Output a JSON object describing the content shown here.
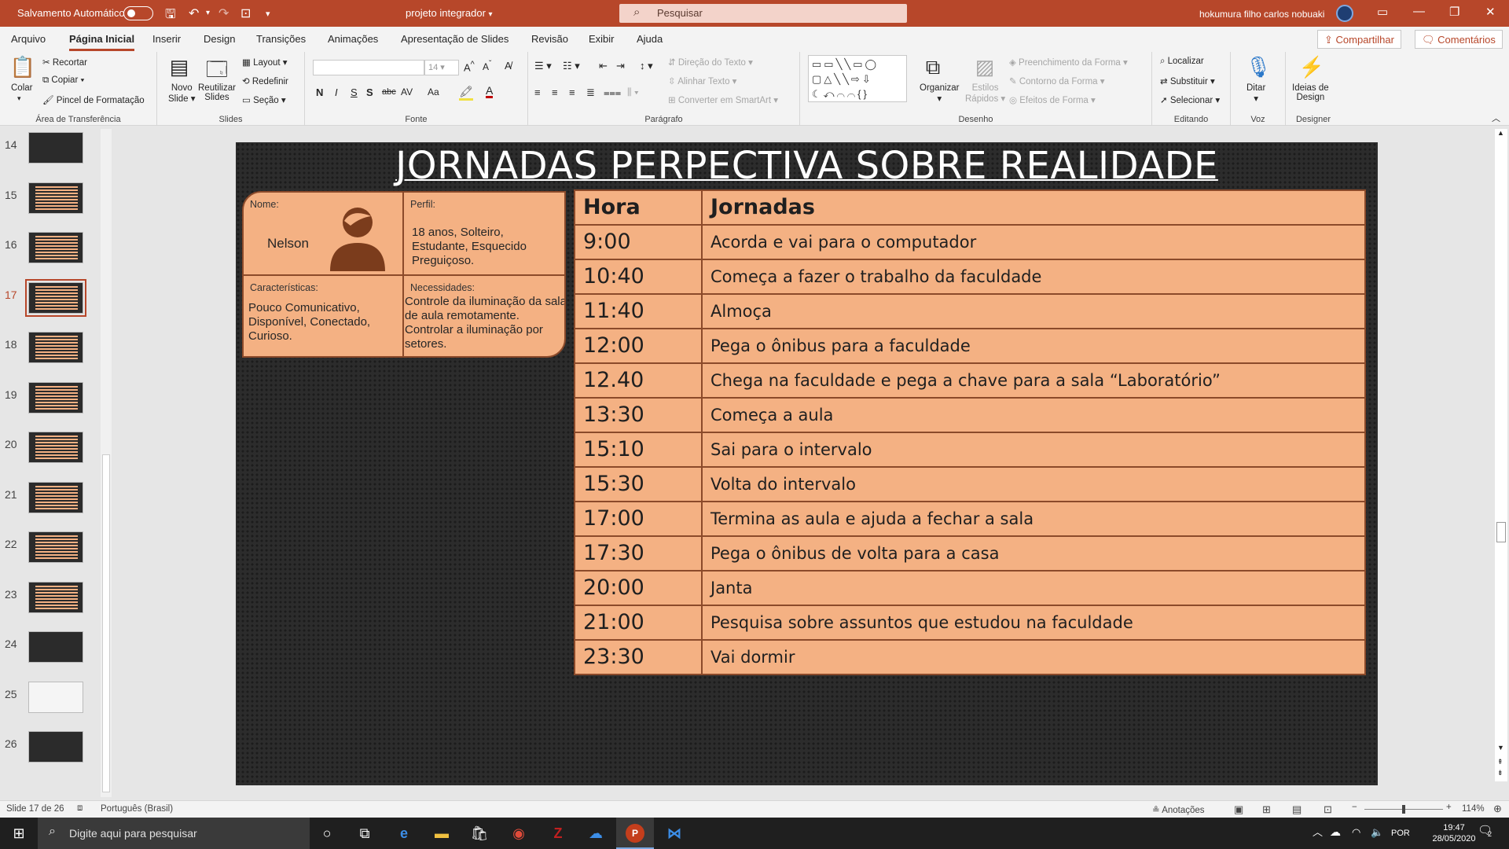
{
  "titlebar": {
    "autosave_label": "Salvamento Automático",
    "doc_title": "projeto integrador",
    "search_placeholder": "Pesquisar",
    "user_name": "hokumura filho carlos nobuaki"
  },
  "tabs": [
    "Arquivo",
    "Página Inicial",
    "Inserir",
    "Design",
    "Transições",
    "Animações",
    "Apresentação de Slides",
    "Revisão",
    "Exibir",
    "Ajuda"
  ],
  "active_tab": "Página Inicial",
  "actions": {
    "share": "Compartilhar",
    "comments": "Comentários"
  },
  "ribbon": {
    "clipboard": {
      "paste": "Colar",
      "cut": "Recortar",
      "copy": "Copiar",
      "format_painter": "Pincel de Formatação",
      "label": "Área de Transferência"
    },
    "slides": {
      "new_slide": "Novo",
      "new_slide2": "Slide",
      "reuse": "Reutilizar",
      "reuse2": "Slides",
      "layout": "Layout",
      "reset": "Redefinir",
      "section": "Seção",
      "label": "Slides"
    },
    "font": {
      "size": "14",
      "bold": "N",
      "italic": "I",
      "underline": "S",
      "shadow": "S",
      "strike": "abc",
      "spacing": "AV",
      "case": "Aa",
      "label": "Fonte"
    },
    "paragraph": {
      "text_direction": "Direção do Texto",
      "align_text": "Alinhar Texto",
      "smartart": "Converter em SmartArt",
      "label": "Parágrafo"
    },
    "drawing": {
      "arrange": "Organizar",
      "quick_styles": "Estilos",
      "quick_styles2": "Rápidos",
      "fill": "Preenchimento da Forma",
      "outline": "Contorno da Forma",
      "effects": "Efeitos de Forma",
      "label": "Desenho"
    },
    "editing": {
      "find": "Localizar",
      "replace": "Substituir",
      "select": "Selecionar",
      "label": "Editando"
    },
    "voice": {
      "dictate": "Ditar",
      "label": "Voz"
    },
    "designer": {
      "ideas": "Ideias de",
      "ideas2": "Design",
      "label": "Designer"
    }
  },
  "thumbnails": [
    {
      "num": "14",
      "style": "mixed"
    },
    {
      "num": "15",
      "style": "table"
    },
    {
      "num": "16",
      "style": "table"
    },
    {
      "num": "17",
      "style": "table-dark",
      "selected": true
    },
    {
      "num": "18",
      "style": "table"
    },
    {
      "num": "19",
      "style": "table"
    },
    {
      "num": "20",
      "style": "table-dark"
    },
    {
      "num": "21",
      "style": "table"
    },
    {
      "num": "22",
      "style": "table"
    },
    {
      "num": "23",
      "style": "table-dark"
    },
    {
      "num": "24",
      "style": "diagram"
    },
    {
      "num": "25",
      "style": "light"
    },
    {
      "num": "26",
      "style": "end"
    }
  ],
  "slide": {
    "title": "JORNADAS PERPECTIVA SOBRE REALIDADE",
    "persona": {
      "name_label": "Nome:",
      "name": "Nelson",
      "profile_label": "Perfil:",
      "profile": "18 anos, Solteiro, Estudante, Esquecido Preguiçoso.",
      "traits_label": "Características:",
      "traits": "Pouco Comunicativo, Disponível, Conectado, Curioso.",
      "needs_label": "Necessidades:",
      "needs": "Controle da iluminação da sala de aula remotamente. Controlar a iluminação por setores."
    },
    "table": {
      "headers": [
        "Hora",
        "Jornadas"
      ],
      "rows": [
        [
          "9:00",
          "Acorda e vai para o computador"
        ],
        [
          "10:40",
          "Começa a fazer o trabalho da faculdade"
        ],
        [
          "11:40",
          "Almoça"
        ],
        [
          "12:00",
          "Pega o ônibus para a faculdade"
        ],
        [
          "12.40",
          "Chega na faculdade e pega a chave para a sala “Laboratório”"
        ],
        [
          "13:30",
          "Começa a aula"
        ],
        [
          "15:10",
          "Sai para o intervalo"
        ],
        [
          "15:30",
          "Volta do intervalo"
        ],
        [
          "17:00",
          "Termina as aula e ajuda a fechar a sala"
        ],
        [
          "17:30",
          "Pega o ônibus de volta para a casa"
        ],
        [
          "20:00",
          "Janta"
        ],
        [
          "21:00",
          "Pesquisa sobre assuntos que estudou na faculdade"
        ],
        [
          "23:30",
          "Vai dormir"
        ]
      ]
    }
  },
  "statusbar": {
    "slide_info": "Slide 17 de 26",
    "language": "Português (Brasil)",
    "notes": "Anotações",
    "zoom": "114%"
  },
  "taskbar": {
    "search_placeholder": "Digite aqui para pesquisar",
    "lang": "POR",
    "time": "19:47",
    "date": "28/05/2020",
    "notif_count": "2"
  },
  "colors": {
    "accent": "#b7472a",
    "cell": "#f4b183",
    "border": "#8b4a2a",
    "slide_bg": "#2c2c2c"
  }
}
